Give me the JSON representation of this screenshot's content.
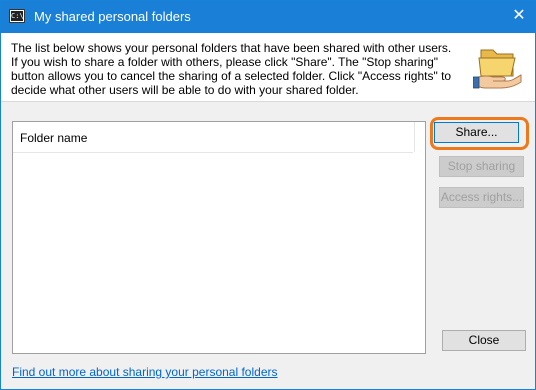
{
  "window": {
    "title": "My shared personal folders",
    "close_glyph": "✕"
  },
  "app_icon": {
    "name": "console-icon",
    "glyph": "C:\\"
  },
  "intro_text": "The list below shows your personal folders that have been shared with other users. If you wish to share a folder with others, please click \"Share\". The \"Stop sharing\" button allows you to cancel the sharing of a selected folder. Click \"Access rights\" to decide what other users will be able to do with your shared folder.",
  "header_icon": "shared-folder-hand-icon",
  "list": {
    "columns": [
      "Folder name"
    ],
    "rows": []
  },
  "buttons": {
    "share": "Share...",
    "stop_sharing": "Stop sharing",
    "access_rights": "Access rights...",
    "close": "Close"
  },
  "help_link": "Find out more about sharing your personal folders",
  "colors": {
    "titlebar": "#1a7fd6",
    "highlight": "#ec7a1c",
    "link": "#0066cc"
  }
}
